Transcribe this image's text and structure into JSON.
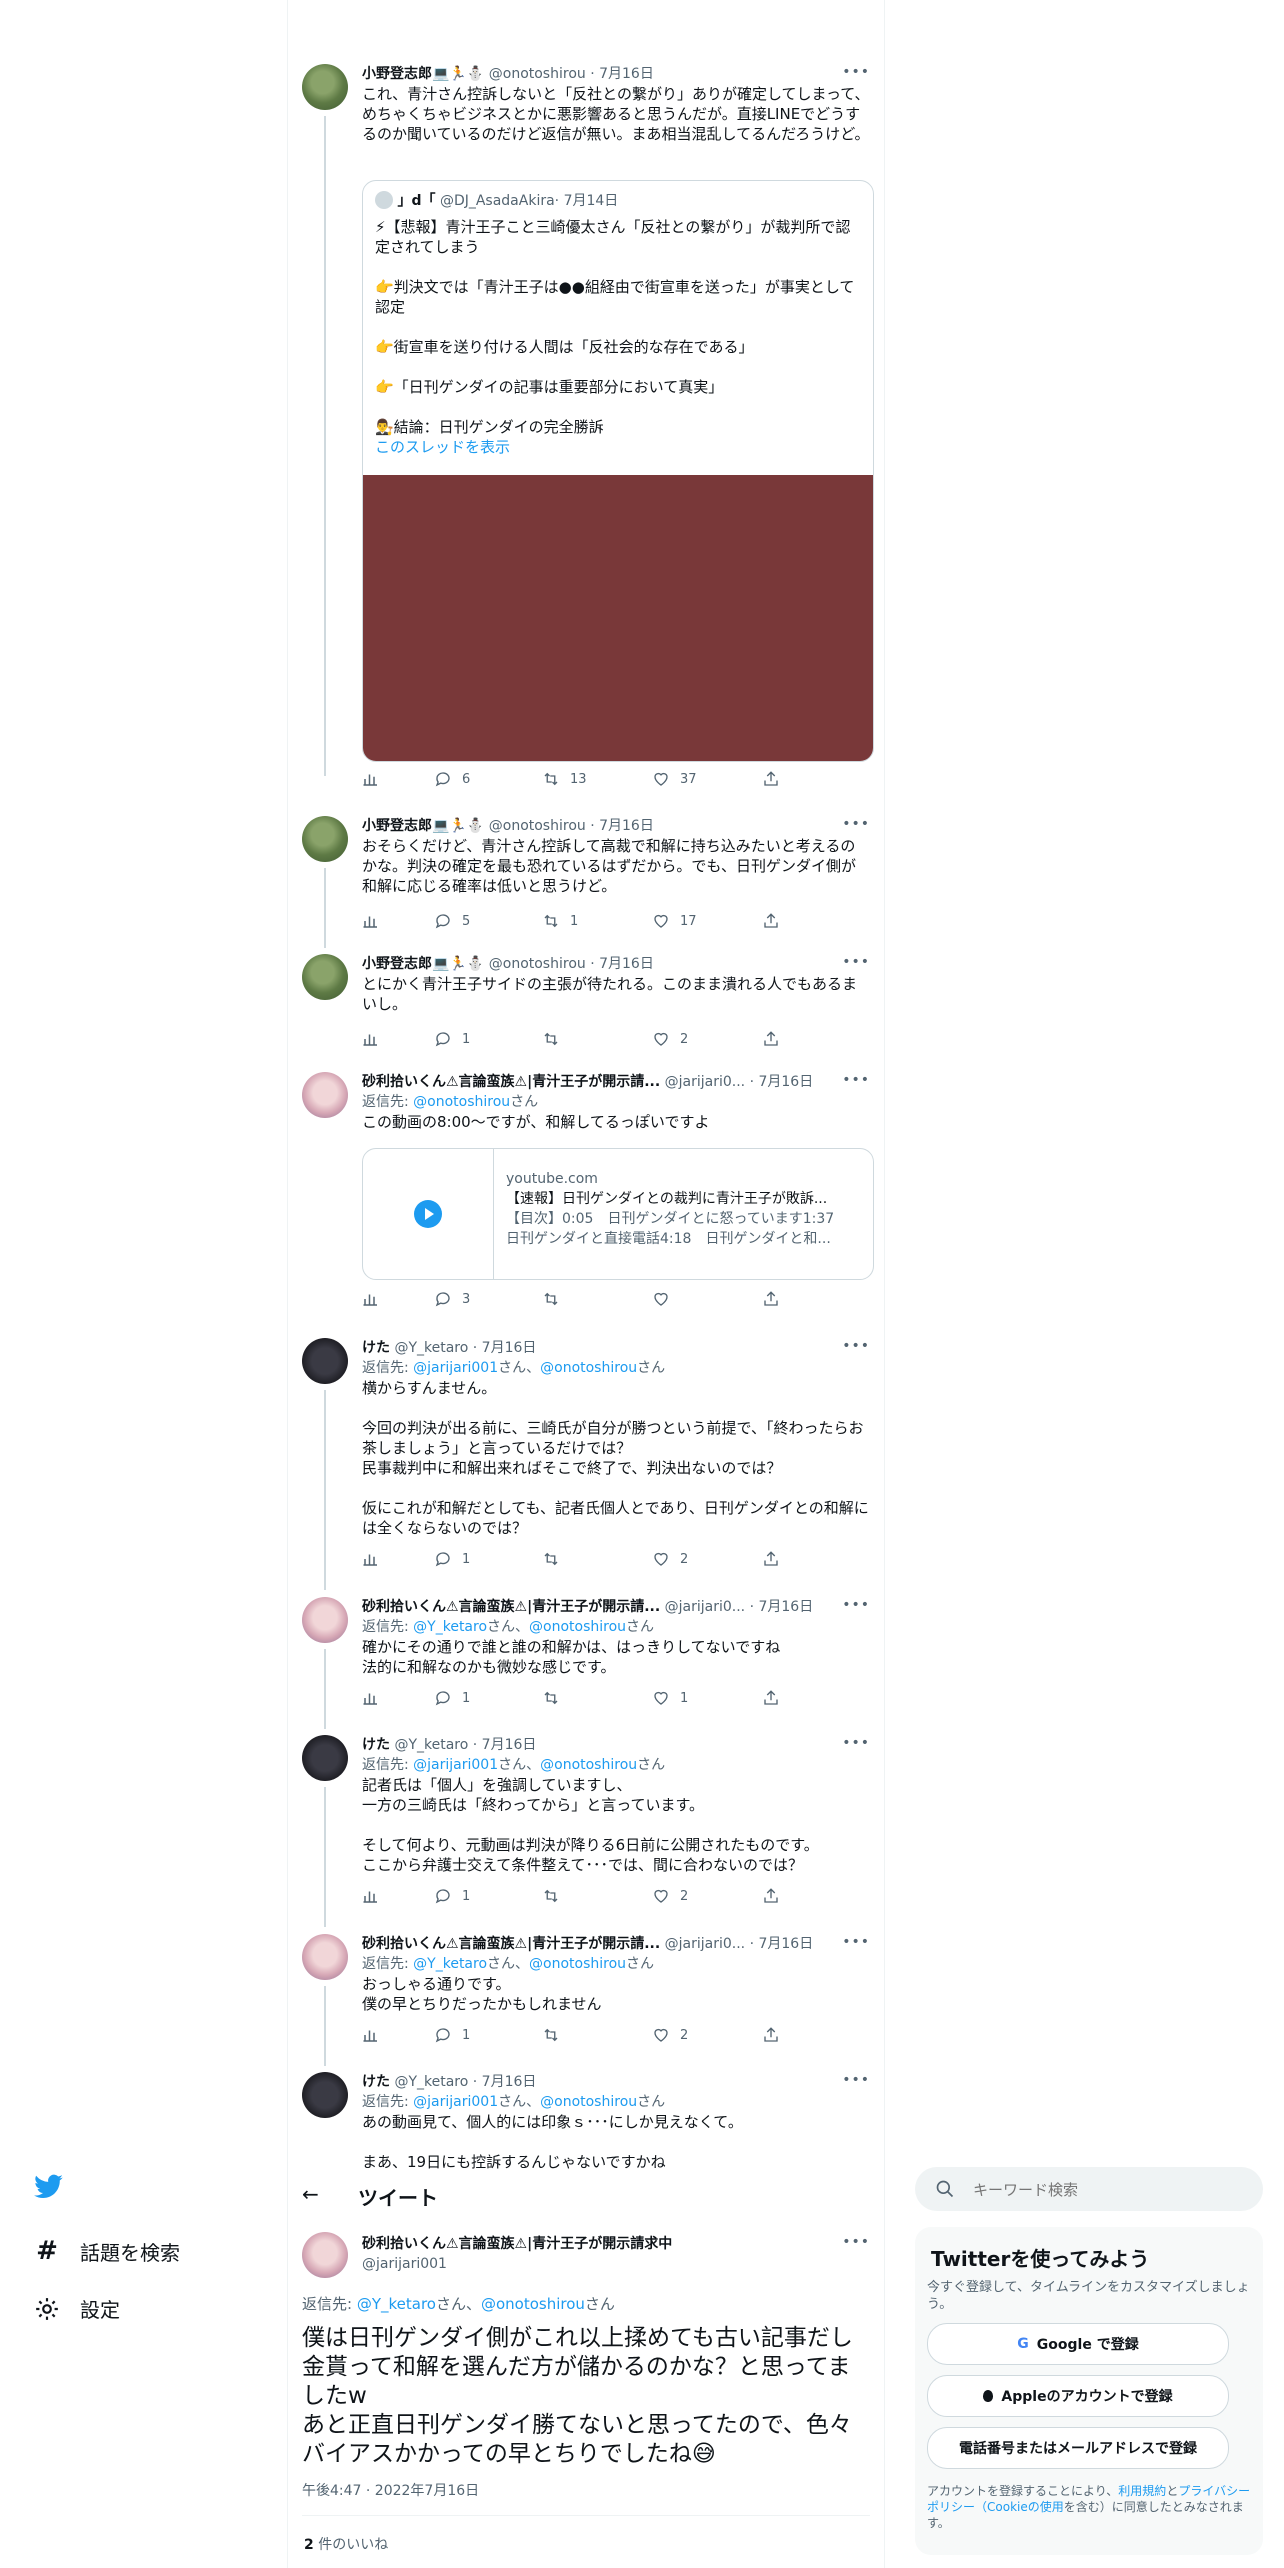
{
  "colors": {
    "accent": "#1d9bf0",
    "text": "#0f1419",
    "muted": "#536471",
    "border": "#cfd9de",
    "media": "#793839"
  },
  "tweets": {
    "t1": {
      "name": "小野登志郎",
      "badges": "💻🏃⛄",
      "handle": "@onotoshirou",
      "date": "· 7月16日",
      "text": "これ、青汁さん控訴しないと「反社との繋がり」ありが確定してしまって、めちゃくちゃビジネスとかに悪影響あると思うんだが。直接LINEでどうするのか聞いているのだけど返信が無い。まあ相当混乱してるんだろうけど。",
      "quote": {
        "name": "」d「",
        "handle": "@DJ_AsadaAkira",
        "date": "· 7月14日",
        "text": "⚡【悲報】青汁王子こと三崎優太さん「反社との繋がり」が裁判所で認定されてしまう\n\n👉判決文では「青汁王子は●●組経由で街宣車を送った」が事実として認定\n\n👉街宣車を送り付ける人間は「反社会的な存在である」\n\n👉「日刊ゲンダイの記事は重要部分において真実」\n\n👨‍⚖️結論：日刊ゲンダイの完全勝訴",
        "show_thread": "このスレッドを表示"
      },
      "replies": "6",
      "retweets": "13",
      "likes": "37"
    },
    "t2": {
      "name": "小野登志郎",
      "badges": "💻🏃⛄",
      "handle": "@onotoshirou",
      "date": "· 7月16日",
      "text": "おそらくだけど、青汁さん控訴して高裁で和解に持ち込みたいと考えるのかな。判決の確定を最も恐れているはずだから。でも、日刊ゲンダイ側が和解に応じる確率は低いと思うけど。",
      "replies": "5",
      "retweets": "1",
      "likes": "17"
    },
    "t3": {
      "name": "小野登志郎",
      "badges": "💻🏃⛄",
      "handle": "@onotoshirou",
      "date": "· 7月16日",
      "text": "とにかく青汁王子サイドの主張が待たれる。このまま潰れる人でもあるまいし。",
      "replies": "1",
      "retweets": "",
      "likes": "2"
    },
    "t4": {
      "name": "砂利拾いくん⚠言論蛮族⚠|青汁王子が開示請...",
      "handle": "@jarijari0...",
      "date": "· 7月16日",
      "reply_prefix": "返信先: ",
      "reply_to": "@onotoshirou",
      "reply_suffix": "さん",
      "text": "この動画の8:00〜ですが、和解してるっぽいですよ",
      "card": {
        "domain": "youtube.com",
        "title": "【速報】日刊ゲンダイとの裁判に青汁王子が敗訴...",
        "desc": "【目次】0:05　日刊ゲンダイとに怒っています1:37　日刊ゲンダイと直接電話4:18　日刊ゲンダイと和..."
      },
      "replies": "3",
      "retweets": "",
      "likes": ""
    },
    "t5": {
      "name": "けた",
      "handle": "@Y_ketaro",
      "date": "· 7月16日",
      "reply_prefix": "返信先: ",
      "reply_to": "@jarijari001",
      "reply_mid": "さん、",
      "reply_to2": "@onotoshirou",
      "reply_suffix": "さん",
      "text": "横からすんません。\n\n今回の判決が出る前に、三崎氏が自分が勝つという前提で、「終わったらお茶しましょう」と言っているだけでは？\n民事裁判中に和解出来ればそこで終了で、判決出ないのでは？\n\n仮にこれが和解だとしても、記者氏個人とであり、日刊ゲンダイとの和解には全くならないのでは？",
      "replies": "1",
      "retweets": "",
      "likes": "2"
    },
    "t6": {
      "name": "砂利拾いくん⚠言論蛮族⚠|青汁王子が開示請...",
      "handle": "@jarijari0...",
      "date": "· 7月16日",
      "reply_prefix": "返信先: ",
      "reply_to": "@Y_ketaro",
      "reply_mid": "さん、",
      "reply_to2": "@onotoshirou",
      "reply_suffix": "さん",
      "text": "確かにその通りで誰と誰の和解かは、はっきりしてないですね\n法的に和解なのかも微妙な感じです。",
      "replies": "1",
      "retweets": "",
      "likes": "1"
    },
    "t7": {
      "name": "けた",
      "handle": "@Y_ketaro",
      "date": "· 7月16日",
      "reply_prefix": "返信先: ",
      "reply_to": "@jarijari001",
      "reply_mid": "さん、",
      "reply_to2": "@onotoshirou",
      "reply_suffix": "さん",
      "text": "記者氏は「個人」を強調していますし、\n一方の三崎氏は「終わってから」と言っています。\n\nそして何より、元動画は判決が降りる6日前に公開されたものです。\nここから弁護士交えて条件整えて･･･では、間に合わないのでは？",
      "replies": "1",
      "retweets": "",
      "likes": "2"
    },
    "t8": {
      "name": "砂利拾いくん⚠言論蛮族⚠|青汁王子が開示請...",
      "handle": "@jarijari0...",
      "date": "· 7月16日",
      "reply_prefix": "返信先: ",
      "reply_to": "@Y_ketaro",
      "reply_mid": "さん、",
      "reply_to2": "@onotoshirou",
      "reply_suffix": "さん",
      "text": "おっしゃる通りです。\n僕の早とちりだったかもしれません",
      "replies": "1",
      "retweets": "",
      "likes": "2"
    },
    "t9": {
      "name": "けた",
      "handle": "@Y_ketaro",
      "date": "· 7月16日",
      "reply_prefix": "返信先: ",
      "reply_to": "@jarijari001",
      "reply_mid": "さん、",
      "reply_to2": "@onotoshirou",
      "reply_suffix": "さん",
      "text": "あの動画見て、個人的には印象ｓ･･･にしか見えなくて。\n\nまあ、19日にも控訴するんじゃないですかね"
    }
  },
  "nav": {
    "logo": "twitter-bird",
    "explore": "話題を検索",
    "settings": "設定"
  },
  "header": {
    "title": "ツイート",
    "back": "←"
  },
  "focus": {
    "name": "砂利拾いくん⚠言論蛮族⚠|青汁王子が開示請求中",
    "handle": "@jarijari001",
    "reply_prefix": "返信先: ",
    "reply_to": "@Y_ketaro",
    "reply_mid": "さん、",
    "reply_to2": "@onotoshirou",
    "reply_suffix": "さん",
    "text": "僕は日刊ゲンダイ側がこれ以上揉めても古い記事だし金貰って和解を選んだ方が儲かるのかな？と思ってましたw\nあと正直日刊ゲンダイ勝てないと思ってたので、色々バイアスかかっての早とちりでしたね😅",
    "timestamp": "午後4:47 · 2022年7月16日",
    "likes_count": "2",
    "likes_label": " 件のいいね"
  },
  "search": {
    "placeholder": "キーワード検索"
  },
  "signup": {
    "title": "Twitterを使ってみよう",
    "subtitle": "今すぐ登録して、タイムラインをカスタマイズしましょう。",
    "google": "Google で登録",
    "apple": "Appleのアカウントで登録",
    "phone": "電話番号またはメールアドレスで登録",
    "legal_pre": "アカウントを登録することにより、",
    "terms": "利用規約",
    "and": "と",
    "privacy": "プライバシーポリシー",
    "cookie": "（Cookieの使用",
    "legal_post": "を含む）に同意したとみなされます。"
  }
}
